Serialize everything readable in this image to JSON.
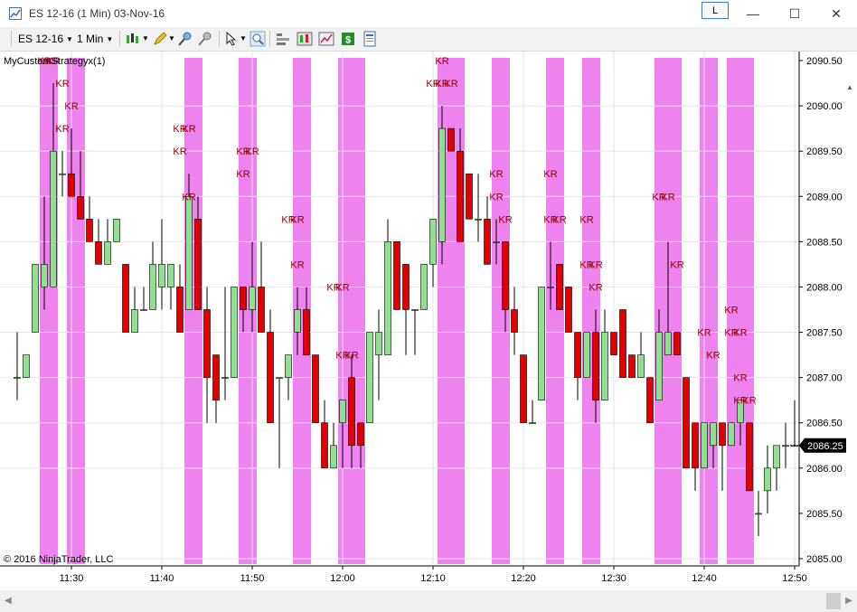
{
  "window": {
    "title": "ES 12-16 (1 Min)  03-Nov-16",
    "link_button": "L",
    "minimize": "—",
    "maximize": "☐",
    "close": "✕"
  },
  "toolbar": {
    "instrument": "ES 12-16",
    "interval": "1 Min"
  },
  "chart": {
    "strategy_label": "MyCustomStrategyx(1)",
    "copyright": "© 2016 NinjaTrader, LLC",
    "current_price": "2086.25",
    "y_ticks": [
      "2090.50",
      "2090.00",
      "2089.50",
      "2089.00",
      "2088.50",
      "2088.00",
      "2087.50",
      "2087.00",
      "2086.50",
      "2086.00",
      "2085.50",
      "2085.00"
    ],
    "x_ticks": [
      "11:30",
      "11:40",
      "11:50",
      "12:00",
      "12:10",
      "12:20",
      "12:30",
      "12:40",
      "12:50"
    ],
    "marker_text": "KR",
    "colors": {
      "up": "#90e090",
      "down": "#e00000",
      "highlight": "#ee82ee",
      "bg": "#ffffff"
    }
  },
  "chart_data": {
    "type": "candlestick",
    "ylim": [
      2085.0,
      2090.5
    ],
    "candles": [
      {
        "t": "11:24",
        "o": 2087.0,
        "h": 2087.5,
        "l": 2086.75,
        "c": 2087.0
      },
      {
        "t": "11:25",
        "o": 2087.0,
        "h": 2087.25,
        "l": 2087.0,
        "c": 2087.25
      },
      {
        "t": "11:26",
        "o": 2087.5,
        "h": 2088.25,
        "l": 2087.5,
        "c": 2088.25
      },
      {
        "t": "11:27",
        "o": 2088.0,
        "h": 2089.0,
        "l": 2087.75,
        "c": 2088.25
      },
      {
        "t": "11:28",
        "o": 2088.0,
        "h": 2090.25,
        "l": 2088.0,
        "c": 2089.5
      },
      {
        "t": "11:29",
        "o": 2089.25,
        "h": 2089.5,
        "l": 2089.0,
        "c": 2089.25
      },
      {
        "t": "11:30",
        "o": 2089.25,
        "h": 2089.75,
        "l": 2089.0,
        "c": 2089.0
      },
      {
        "t": "11:31",
        "o": 2089.0,
        "h": 2089.5,
        "l": 2088.75,
        "c": 2088.75
      },
      {
        "t": "11:32",
        "o": 2088.75,
        "h": 2089.0,
        "l": 2088.5,
        "c": 2088.5
      },
      {
        "t": "11:33",
        "o": 2088.5,
        "h": 2088.75,
        "l": 2088.25,
        "c": 2088.25
      },
      {
        "t": "11:34",
        "o": 2088.25,
        "h": 2088.75,
        "l": 2088.25,
        "c": 2088.5
      },
      {
        "t": "11:35",
        "o": 2088.5,
        "h": 2088.75,
        "l": 2088.5,
        "c": 2088.75
      },
      {
        "t": "11:36",
        "o": 2088.25,
        "h": 2088.25,
        "l": 2087.5,
        "c": 2087.5
      },
      {
        "t": "11:37",
        "o": 2087.5,
        "h": 2088.0,
        "l": 2087.5,
        "c": 2087.75
      },
      {
        "t": "11:38",
        "o": 2087.75,
        "h": 2088.0,
        "l": 2087.75,
        "c": 2087.75
      },
      {
        "t": "11:39",
        "o": 2087.75,
        "h": 2088.5,
        "l": 2087.75,
        "c": 2088.25
      },
      {
        "t": "11:40",
        "o": 2088.0,
        "h": 2088.75,
        "l": 2087.75,
        "c": 2088.25
      },
      {
        "t": "11:41",
        "o": 2088.0,
        "h": 2088.25,
        "l": 2087.75,
        "c": 2088.25
      },
      {
        "t": "11:42",
        "o": 2088.0,
        "h": 2088.25,
        "l": 2087.5,
        "c": 2087.5
      },
      {
        "t": "11:43",
        "o": 2087.75,
        "h": 2089.25,
        "l": 2087.75,
        "c": 2089.0
      },
      {
        "t": "11:44",
        "o": 2088.75,
        "h": 2089.0,
        "l": 2087.75,
        "c": 2087.75
      },
      {
        "t": "11:45",
        "o": 2087.75,
        "h": 2088.0,
        "l": 2086.5,
        "c": 2087.0
      },
      {
        "t": "11:46",
        "o": 2087.25,
        "h": 2087.25,
        "l": 2086.5,
        "c": 2086.75
      },
      {
        "t": "11:47",
        "o": 2087.0,
        "h": 2088.0,
        "l": 2086.75,
        "c": 2087.0
      },
      {
        "t": "11:48",
        "o": 2087.0,
        "h": 2088.0,
        "l": 2087.0,
        "c": 2088.0
      },
      {
        "t": "11:49",
        "o": 2088.0,
        "h": 2088.0,
        "l": 2087.5,
        "c": 2087.75
      },
      {
        "t": "11:50",
        "o": 2087.75,
        "h": 2088.5,
        "l": 2087.5,
        "c": 2088.0
      },
      {
        "t": "11:51",
        "o": 2088.0,
        "h": 2088.5,
        "l": 2087.5,
        "c": 2087.5
      },
      {
        "t": "11:52",
        "o": 2087.5,
        "h": 2087.75,
        "l": 2086.5,
        "c": 2086.5
      },
      {
        "t": "11:53",
        "o": 2087.0,
        "h": 2087.0,
        "l": 2086.0,
        "c": 2087.0
      },
      {
        "t": "11:54",
        "o": 2087.0,
        "h": 2087.25,
        "l": 2086.75,
        "c": 2087.25
      },
      {
        "t": "11:55",
        "o": 2087.5,
        "h": 2088.0,
        "l": 2087.25,
        "c": 2087.75
      },
      {
        "t": "11:56",
        "o": 2087.75,
        "h": 2088.0,
        "l": 2087.25,
        "c": 2087.25
      },
      {
        "t": "11:57",
        "o": 2087.25,
        "h": 2087.25,
        "l": 2086.5,
        "c": 2086.5
      },
      {
        "t": "11:58",
        "o": 2086.5,
        "h": 2086.75,
        "l": 2086.0,
        "c": 2086.0
      },
      {
        "t": "11:59",
        "o": 2086.0,
        "h": 2086.5,
        "l": 2086.0,
        "c": 2086.25
      },
      {
        "t": "12:00",
        "o": 2086.5,
        "h": 2086.75,
        "l": 2086.0,
        "c": 2086.75
      },
      {
        "t": "12:01",
        "o": 2087.0,
        "h": 2087.25,
        "l": 2086.0,
        "c": 2086.25
      },
      {
        "t": "12:02",
        "o": 2086.5,
        "h": 2086.5,
        "l": 2086.0,
        "c": 2086.25
      },
      {
        "t": "12:03",
        "o": 2086.5,
        "h": 2087.5,
        "l": 2086.5,
        "c": 2087.5
      },
      {
        "t": "12:04",
        "o": 2087.25,
        "h": 2087.75,
        "l": 2086.75,
        "c": 2087.5
      },
      {
        "t": "12:05",
        "o": 2087.25,
        "h": 2088.75,
        "l": 2087.25,
        "c": 2088.5
      },
      {
        "t": "12:06",
        "o": 2088.5,
        "h": 2088.5,
        "l": 2087.75,
        "c": 2087.75
      },
      {
        "t": "12:07",
        "o": 2088.25,
        "h": 2088.25,
        "l": 2087.25,
        "c": 2087.75
      },
      {
        "t": "12:08",
        "o": 2087.75,
        "h": 2087.75,
        "l": 2087.25,
        "c": 2087.75
      },
      {
        "t": "12:09",
        "o": 2087.75,
        "h": 2088.25,
        "l": 2087.75,
        "c": 2088.25
      },
      {
        "t": "12:10",
        "o": 2088.25,
        "h": 2088.75,
        "l": 2088.0,
        "c": 2088.75
      },
      {
        "t": "12:11",
        "o": 2088.5,
        "h": 2090.0,
        "l": 2088.25,
        "c": 2089.75
      },
      {
        "t": "12:12",
        "o": 2089.75,
        "h": 2089.75,
        "l": 2089.5,
        "c": 2089.5
      },
      {
        "t": "12:13",
        "o": 2089.5,
        "h": 2089.75,
        "l": 2088.5,
        "c": 2088.5
      },
      {
        "t": "12:14",
        "o": 2089.25,
        "h": 2089.25,
        "l": 2088.75,
        "c": 2088.75
      },
      {
        "t": "12:15",
        "o": 2088.75,
        "h": 2089.25,
        "l": 2088.5,
        "c": 2088.75
      },
      {
        "t": "12:16",
        "o": 2088.75,
        "h": 2089.0,
        "l": 2088.25,
        "c": 2088.25
      },
      {
        "t": "12:17",
        "o": 2088.5,
        "h": 2088.75,
        "l": 2088.25,
        "c": 2088.5
      },
      {
        "t": "12:18",
        "o": 2088.5,
        "h": 2088.5,
        "l": 2087.5,
        "c": 2087.75
      },
      {
        "t": "12:19",
        "o": 2087.75,
        "h": 2088.0,
        "l": 2087.25,
        "c": 2087.5
      },
      {
        "t": "12:20",
        "o": 2087.25,
        "h": 2087.25,
        "l": 2086.5,
        "c": 2086.5
      },
      {
        "t": "12:21",
        "o": 2086.5,
        "h": 2086.75,
        "l": 2086.5,
        "c": 2086.5
      },
      {
        "t": "12:22",
        "o": 2086.75,
        "h": 2088.0,
        "l": 2086.75,
        "c": 2088.0
      },
      {
        "t": "12:23",
        "o": 2088.0,
        "h": 2088.5,
        "l": 2087.75,
        "c": 2088.0
      },
      {
        "t": "12:24",
        "o": 2088.25,
        "h": 2088.25,
        "l": 2087.75,
        "c": 2087.75
      },
      {
        "t": "12:25",
        "o": 2088.0,
        "h": 2088.0,
        "l": 2087.5,
        "c": 2087.5
      },
      {
        "t": "12:26",
        "o": 2087.5,
        "h": 2087.5,
        "l": 2086.75,
        "c": 2087.0
      },
      {
        "t": "12:27",
        "o": 2087.0,
        "h": 2087.5,
        "l": 2087.0,
        "c": 2087.5
      },
      {
        "t": "12:28",
        "o": 2087.5,
        "h": 2087.75,
        "l": 2086.5,
        "c": 2086.75
      },
      {
        "t": "12:29",
        "o": 2086.75,
        "h": 2087.75,
        "l": 2086.75,
        "c": 2087.5
      },
      {
        "t": "12:30",
        "o": 2087.5,
        "h": 2087.5,
        "l": 2087.25,
        "c": 2087.25
      },
      {
        "t": "12:31",
        "o": 2087.75,
        "h": 2087.75,
        "l": 2087.0,
        "c": 2087.0
      },
      {
        "t": "12:32",
        "o": 2087.25,
        "h": 2087.25,
        "l": 2087.0,
        "c": 2087.0
      },
      {
        "t": "12:33",
        "o": 2087.0,
        "h": 2087.5,
        "l": 2087.0,
        "c": 2087.25
      },
      {
        "t": "12:34",
        "o": 2087.0,
        "h": 2087.0,
        "l": 2086.5,
        "c": 2086.5
      },
      {
        "t": "12:35",
        "o": 2086.75,
        "h": 2087.75,
        "l": 2086.75,
        "c": 2087.5
      },
      {
        "t": "12:36",
        "o": 2087.25,
        "h": 2088.5,
        "l": 2087.25,
        "c": 2087.5
      },
      {
        "t": "12:37",
        "o": 2087.5,
        "h": 2087.5,
        "l": 2087.25,
        "c": 2087.25
      },
      {
        "t": "12:38",
        "o": 2087.0,
        "h": 2087.0,
        "l": 2086.0,
        "c": 2086.0
      },
      {
        "t": "12:39",
        "o": 2086.5,
        "h": 2086.5,
        "l": 2085.75,
        "c": 2086.0
      },
      {
        "t": "12:40",
        "o": 2086.0,
        "h": 2086.5,
        "l": 2086.0,
        "c": 2086.5
      },
      {
        "t": "12:41",
        "o": 2086.25,
        "h": 2086.5,
        "l": 2086.0,
        "c": 2086.5
      },
      {
        "t": "12:42",
        "o": 2086.5,
        "h": 2086.5,
        "l": 2085.75,
        "c": 2086.25
      },
      {
        "t": "12:43",
        "o": 2086.25,
        "h": 2086.5,
        "l": 2086.25,
        "c": 2086.5
      },
      {
        "t": "12:44",
        "o": 2086.5,
        "h": 2086.75,
        "l": 2086.25,
        "c": 2086.75
      },
      {
        "t": "12:45",
        "o": 2086.5,
        "h": 2086.5,
        "l": 2085.75,
        "c": 2085.75
      },
      {
        "t": "12:46",
        "o": 2085.5,
        "h": 2085.75,
        "l": 2085.25,
        "c": 2085.5
      },
      {
        "t": "12:47",
        "o": 2085.75,
        "h": 2086.25,
        "l": 2085.5,
        "c": 2086.0
      },
      {
        "t": "12:48",
        "o": 2086.0,
        "h": 2086.25,
        "l": 2085.75,
        "c": 2086.25
      },
      {
        "t": "12:49",
        "o": 2086.25,
        "h": 2086.5,
        "l": 2086.0,
        "c": 2086.25
      },
      {
        "t": "12:50",
        "o": 2086.25,
        "h": 2086.75,
        "l": 2086.25,
        "c": 2086.25
      }
    ],
    "highlight_bars": [
      "11:27",
      "11:28",
      "11:30",
      "11:31",
      "11:43",
      "11:44",
      "11:49",
      "11:50",
      "11:55",
      "11:56",
      "12:00",
      "12:01",
      "12:02",
      "12:11",
      "12:12",
      "12:13",
      "12:17",
      "12:18",
      "12:23",
      "12:24",
      "12:27",
      "12:28",
      "12:35",
      "12:36",
      "12:37",
      "12:40",
      "12:41",
      "12:43",
      "12:44",
      "12:45"
    ],
    "kr_markers": [
      {
        "t": "11:27",
        "price": 2090.5
      },
      {
        "t": "11:28",
        "price": 2090.5
      },
      {
        "t": "11:29",
        "price": 2090.25
      },
      {
        "t": "11:30",
        "price": 2090.0
      },
      {
        "t": "11:29",
        "price": 2089.75
      },
      {
        "t": "11:42",
        "price": 2089.75
      },
      {
        "t": "11:43",
        "price": 2089.75
      },
      {
        "t": "11:42",
        "price": 2089.5
      },
      {
        "t": "11:43",
        "price": 2089.0
      },
      {
        "t": "11:49",
        "price": 2089.5
      },
      {
        "t": "11:50",
        "price": 2089.5
      },
      {
        "t": "11:49",
        "price": 2089.25
      },
      {
        "t": "11:54",
        "price": 2088.75
      },
      {
        "t": "11:55",
        "price": 2088.75
      },
      {
        "t": "11:55",
        "price": 2088.25
      },
      {
        "t": "11:59",
        "price": 2088.0
      },
      {
        "t": "12:00",
        "price": 2088.0
      },
      {
        "t": "12:00",
        "price": 2087.25
      },
      {
        "t": "12:01",
        "price": 2087.25
      },
      {
        "t": "12:11",
        "price": 2090.5
      },
      {
        "t": "12:10",
        "price": 2090.25
      },
      {
        "t": "12:11",
        "price": 2090.25
      },
      {
        "t": "12:12",
        "price": 2090.25
      },
      {
        "t": "12:17",
        "price": 2089.25
      },
      {
        "t": "12:17",
        "price": 2089.0
      },
      {
        "t": "12:18",
        "price": 2088.75
      },
      {
        "t": "12:23",
        "price": 2089.25
      },
      {
        "t": "12:23",
        "price": 2088.75
      },
      {
        "t": "12:24",
        "price": 2088.75
      },
      {
        "t": "12:27",
        "price": 2088.75
      },
      {
        "t": "12:27",
        "price": 2088.25
      },
      {
        "t": "12:28",
        "price": 2088.25
      },
      {
        "t": "12:28",
        "price": 2088.0
      },
      {
        "t": "12:35",
        "price": 2089.0
      },
      {
        "t": "12:36",
        "price": 2089.0
      },
      {
        "t": "12:37",
        "price": 2088.25
      },
      {
        "t": "12:40",
        "price": 2087.5
      },
      {
        "t": "12:41",
        "price": 2087.25
      },
      {
        "t": "12:43",
        "price": 2087.75
      },
      {
        "t": "12:43",
        "price": 2087.5
      },
      {
        "t": "12:44",
        "price": 2087.5
      },
      {
        "t": "12:44",
        "price": 2087.0
      },
      {
        "t": "12:44",
        "price": 2086.75
      },
      {
        "t": "12:45",
        "price": 2086.75
      }
    ]
  }
}
